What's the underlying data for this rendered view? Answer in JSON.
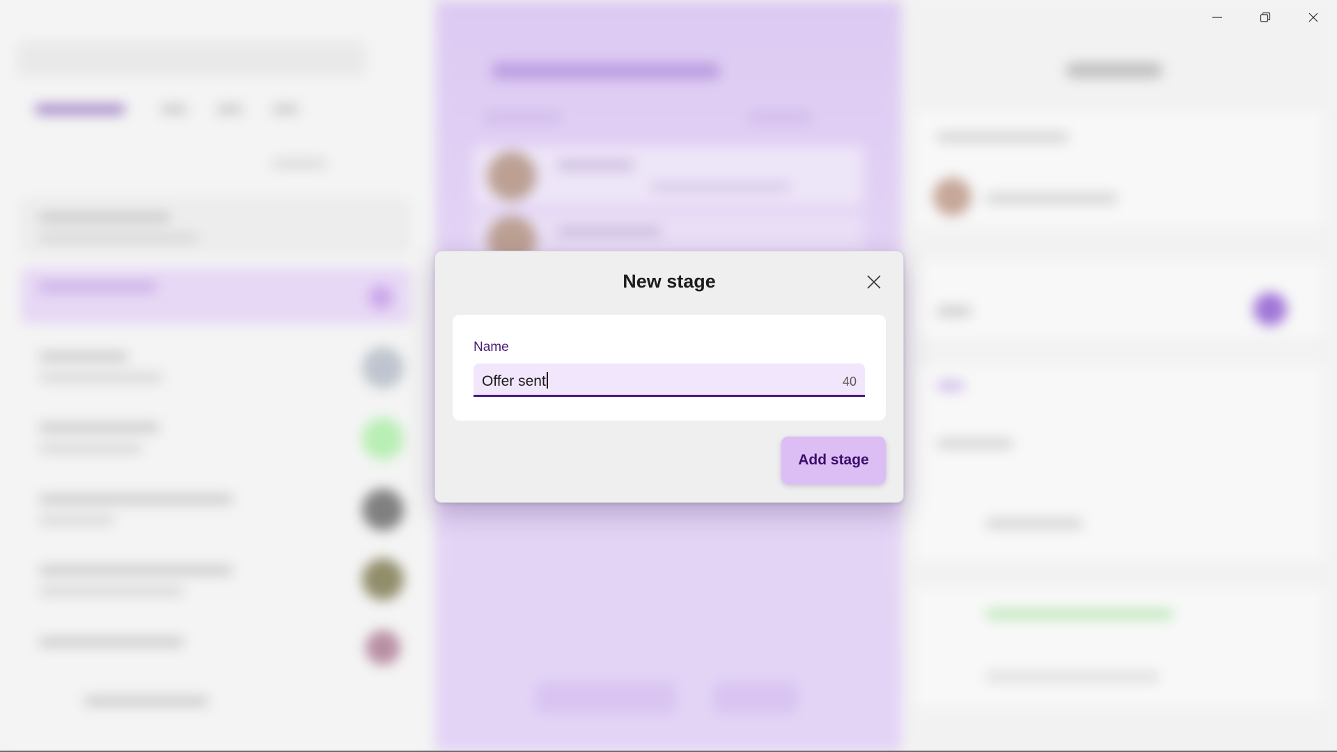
{
  "window": {
    "minimize_icon": "minimize-icon",
    "restore_icon": "restore-icon",
    "close_icon": "close-icon"
  },
  "dialog": {
    "title": "New stage",
    "close_icon": "close-icon",
    "name_label": "Name",
    "name_value": "Offer sent",
    "char_remaining": "40",
    "submit_label": "Add stage"
  },
  "colors": {
    "accent": "#4b1b7e",
    "button_bg": "#dcbdf4",
    "field_bg": "#f1e6fb",
    "backdrop_mid": "#dcc8f3"
  }
}
